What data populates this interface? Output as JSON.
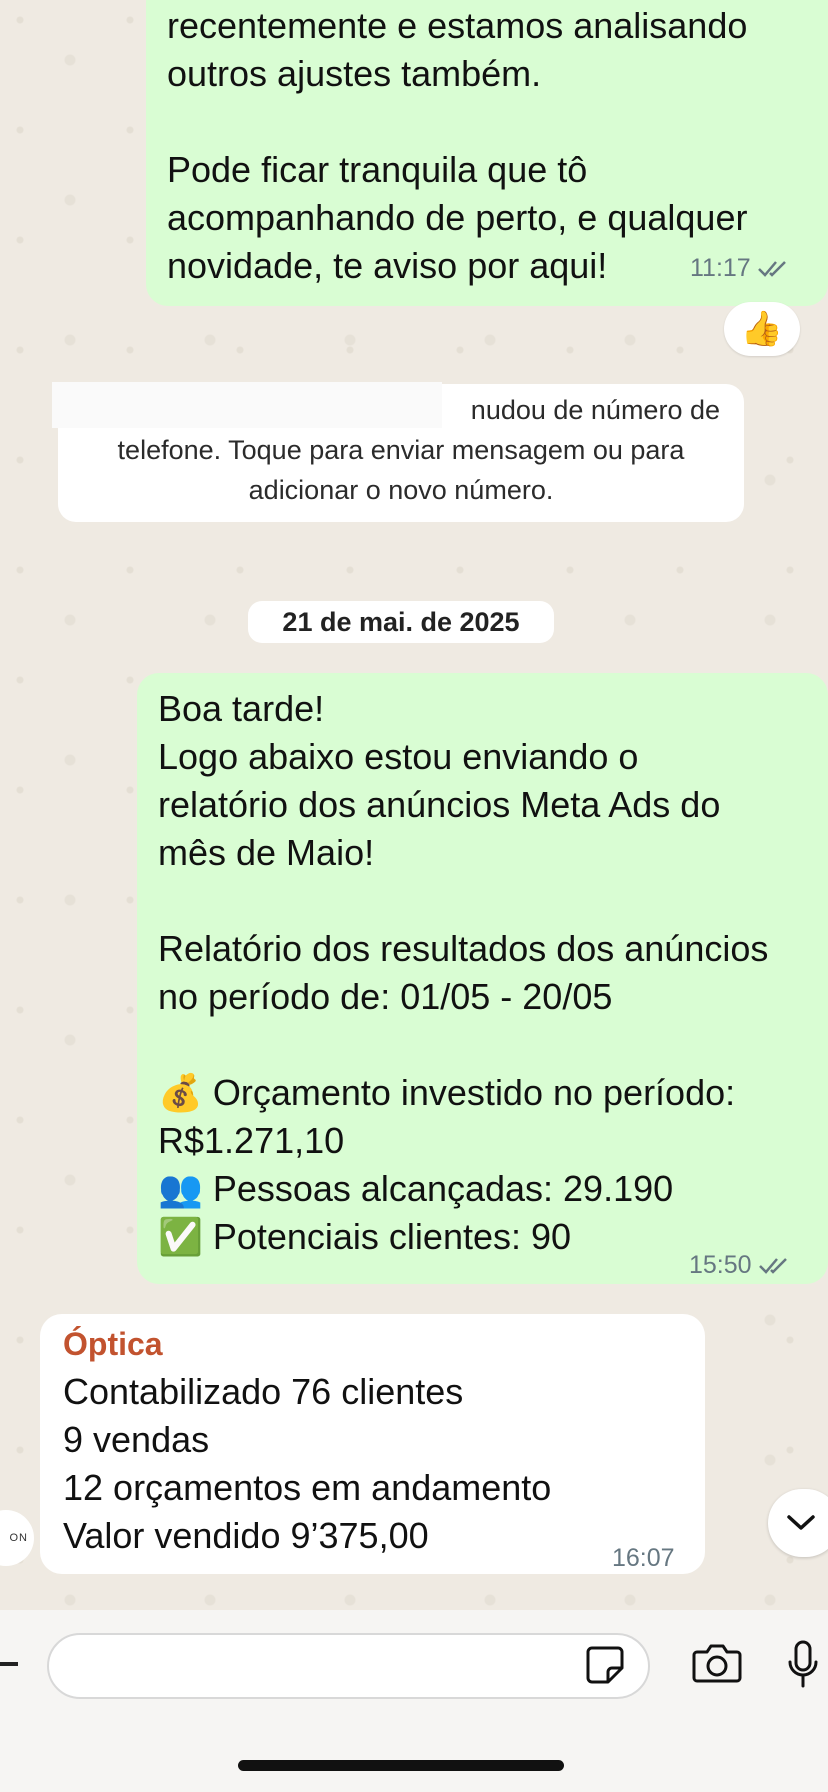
{
  "chat": {
    "messages": [
      {
        "direction": "outgoing",
        "lines": [
          "recentemente e estamos analisando",
          "outros ajustes também.",
          "",
          "Pode ficar tranquila que tô",
          "acompanhando de perto, e qualquer",
          "novidade, te aviso por aqui!"
        ],
        "time": "11:17",
        "status": "read",
        "reaction": "👍"
      },
      {
        "direction": "system",
        "line1": "nudou de número de",
        "line2": "telefone. Toque para enviar mensagem ou para",
        "line3": "adicionar o novo número."
      },
      {
        "direction": "date",
        "label": "21 de mai. de 2025"
      },
      {
        "direction": "outgoing",
        "lines": [
          "Boa tarde!",
          "Logo abaixo estou enviando o",
          "relatório dos anúncios Meta Ads do",
          "mês de Maio!",
          "",
          "Relatório dos resultados dos anúncios",
          "no período de: 01/05 - 20/05",
          "",
          "💰 Orçamento investido no período:",
          "R$1.271,10",
          "👥 Pessoas alcançadas: 29.190",
          "✅ Potenciais clientes: 90"
        ],
        "time": "15:50",
        "status": "read"
      },
      {
        "direction": "incoming",
        "sender": "Óptica",
        "lines": [
          "Contabilizado 76 clientes",
          "9 vendas",
          "12 orçamentos em andamento",
          "Valor vendido 9’375,00"
        ],
        "time": "16:07",
        "avatar_text": "ON"
      }
    ]
  },
  "colors": {
    "outgoing_bubble": "#d9fdd3",
    "incoming_bubble": "#ffffff",
    "chat_background": "#efeae2",
    "sender_name": "#c2532f",
    "read_ticks": "#667781"
  },
  "composer": {
    "icons": [
      "plus-icon",
      "sticker-icon",
      "camera-icon",
      "microphone-icon"
    ]
  },
  "controls": {
    "scroll_down_icon": "chevron-down-icon"
  }
}
